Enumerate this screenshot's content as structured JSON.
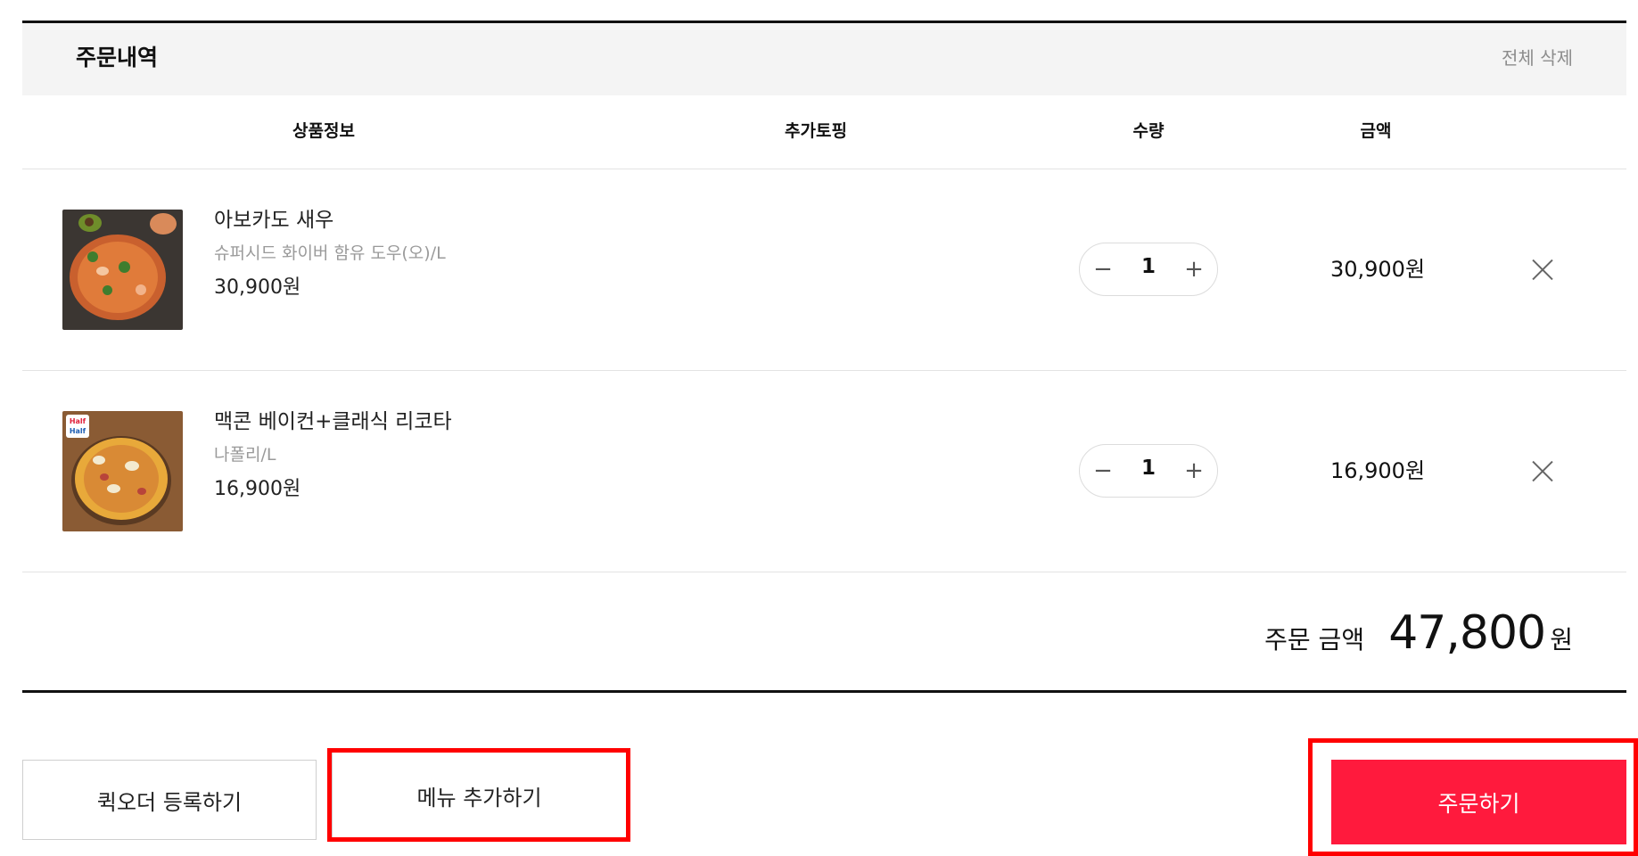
{
  "order": {
    "title": "주문내역",
    "clear_all_label": "전체 삭제",
    "columns": {
      "product": "상품정보",
      "topping": "추가토핑",
      "quantity": "수량",
      "amount": "금액"
    },
    "items": [
      {
        "name": "아보카도 새우",
        "option": "슈퍼시드 화이버 함유 도우(오)/L",
        "unit_price": "30,900원",
        "quantity": "1",
        "total": "30,900원",
        "image": "avocado-shrimp-pizza"
      },
      {
        "name": "맥콘 베이컨+클래식 리코타",
        "option": "나폴리/L",
        "unit_price": "16,900원",
        "quantity": "1",
        "total": "16,900원",
        "image": "half-and-half-pizza",
        "badge_line1": "Half",
        "badge_line2": "Half"
      }
    ],
    "summary": {
      "label": "주문 금액",
      "value": "47,800",
      "unit": "원"
    }
  },
  "actions": {
    "quick_order_label": "퀵오더 등록하기",
    "add_menu_label": "메뉴 추가하기",
    "order_label": "주문하기"
  },
  "icons": {
    "minus": "minus-icon",
    "plus": "plus-icon",
    "remove": "close-icon"
  },
  "colors": {
    "accent": "#ff1a3d",
    "highlight": "#ff0000",
    "muted_text": "#9a9a9a"
  }
}
